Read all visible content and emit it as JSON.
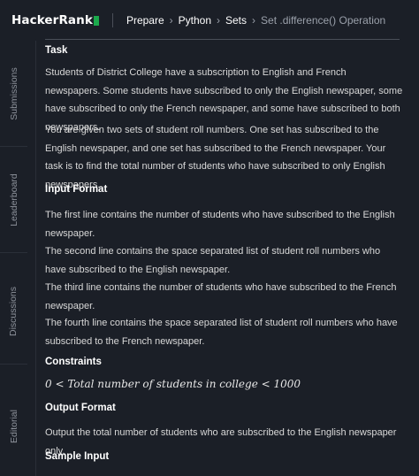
{
  "topbar": {
    "logo_text": "HackerRank",
    "breadcrumb": [
      "Prepare",
      "Python",
      "Sets"
    ],
    "current_page": "Set .difference() Operation",
    "chevron_icon": "chevron-right-icon"
  },
  "sidebar": {
    "tabs": [
      "Submissions",
      "Leaderboard",
      "Discussions",
      "Editorial"
    ]
  },
  "task": {
    "heading": "Task",
    "para1": "Students of District College have a subscription to English and French newspapers. Some students have subscribed to only the English newspaper, some have subscribed to only the French newspaper, and some have subscribed to both newspapers.",
    "para2": "You are given two sets of student roll numbers. One set has subscribed to the English newspaper, and one set has subscribed to the French newspaper. Your task is to find the total number of students who have subscribed to only English newspapers."
  },
  "input_format": {
    "heading": "Input Format",
    "line1": "The first line contains the number of students who have subscribed to the English newspaper.",
    "line2": "The second line contains the space separated list of student roll numbers who have subscribed to the English newspaper.",
    "line3": "The third line contains the number of students who have subscribed to the French newspaper.",
    "line4": "The fourth line contains the space separated list of student roll numbers who have subscribed to the French newspaper."
  },
  "constraints": {
    "heading": "Constraints",
    "expression": "0 < Total number of students in college < 1000"
  },
  "output_format": {
    "heading": "Output Format",
    "text": "Output the total number of students who are subscribed to the English newspaper only."
  },
  "sample_input": {
    "heading": "Sample Input"
  },
  "colors": {
    "background": "#1b1f27",
    "logo_accent": "#1ba94c",
    "heading": "#ffffff",
    "body_text": "#d8d8d8",
    "muted": "#9aa0aa"
  }
}
